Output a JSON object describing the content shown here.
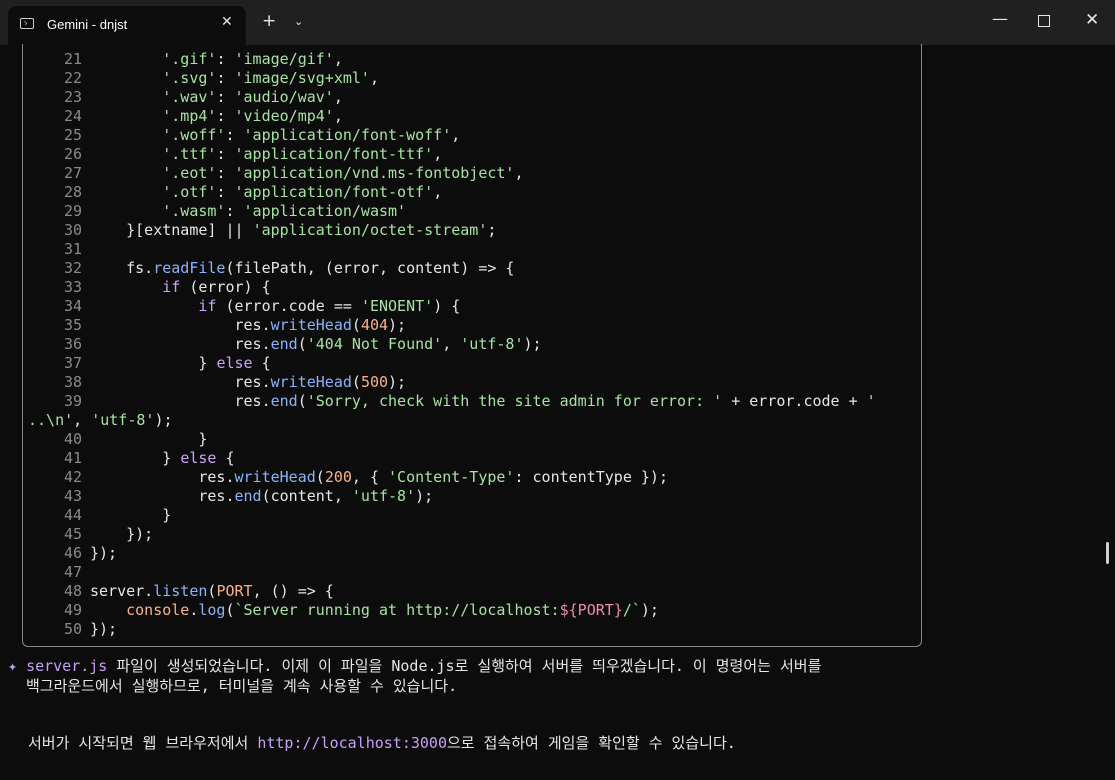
{
  "window": {
    "tab_title": "Gemini - dnjst",
    "close_glyph": "✕",
    "newtab_glyph": "+",
    "dropdown_glyph": "⌄",
    "min_glyph": "—",
    "close_win_glyph": "✕"
  },
  "code_lines": [
    {
      "num": "21",
      "segs": [
        [
          "p",
          "        "
        ],
        [
          "s",
          "'.gif'"
        ],
        [
          "p",
          ": "
        ],
        [
          "s",
          "'image/gif'"
        ],
        [
          "p",
          ","
        ]
      ]
    },
    {
      "num": "22",
      "segs": [
        [
          "p",
          "        "
        ],
        [
          "s",
          "'.svg'"
        ],
        [
          "p",
          ": "
        ],
        [
          "s",
          "'image/svg+xml'"
        ],
        [
          "p",
          ","
        ]
      ]
    },
    {
      "num": "23",
      "segs": [
        [
          "p",
          "        "
        ],
        [
          "s",
          "'.wav'"
        ],
        [
          "p",
          ": "
        ],
        [
          "s",
          "'audio/wav'"
        ],
        [
          "p",
          ","
        ]
      ]
    },
    {
      "num": "24",
      "segs": [
        [
          "p",
          "        "
        ],
        [
          "s",
          "'.mp4'"
        ],
        [
          "p",
          ": "
        ],
        [
          "s",
          "'video/mp4'"
        ],
        [
          "p",
          ","
        ]
      ]
    },
    {
      "num": "25",
      "segs": [
        [
          "p",
          "        "
        ],
        [
          "s",
          "'.woff'"
        ],
        [
          "p",
          ": "
        ],
        [
          "s",
          "'application/font-woff'"
        ],
        [
          "p",
          ","
        ]
      ]
    },
    {
      "num": "26",
      "segs": [
        [
          "p",
          "        "
        ],
        [
          "s",
          "'.ttf'"
        ],
        [
          "p",
          ": "
        ],
        [
          "s",
          "'application/font-ttf'"
        ],
        [
          "p",
          ","
        ]
      ]
    },
    {
      "num": "27",
      "segs": [
        [
          "p",
          "        "
        ],
        [
          "s",
          "'.eot'"
        ],
        [
          "p",
          ": "
        ],
        [
          "s",
          "'application/vnd.ms-fontobject'"
        ],
        [
          "p",
          ","
        ]
      ]
    },
    {
      "num": "28",
      "segs": [
        [
          "p",
          "        "
        ],
        [
          "s",
          "'.otf'"
        ],
        [
          "p",
          ": "
        ],
        [
          "s",
          "'application/font-otf'"
        ],
        [
          "p",
          ","
        ]
      ]
    },
    {
      "num": "29",
      "segs": [
        [
          "p",
          "        "
        ],
        [
          "s",
          "'.wasm'"
        ],
        [
          "p",
          ": "
        ],
        [
          "s",
          "'application/wasm'"
        ]
      ]
    },
    {
      "num": "30",
      "segs": [
        [
          "p",
          "    }[extname] || "
        ],
        [
          "s",
          "'application/octet-stream'"
        ],
        [
          "p",
          ";"
        ]
      ]
    },
    {
      "num": "31",
      "segs": []
    },
    {
      "num": "32",
      "segs": [
        [
          "p",
          "    fs."
        ],
        [
          "f",
          "readFile"
        ],
        [
          "p",
          "(filePath, (error, content) => {"
        ]
      ]
    },
    {
      "num": "33",
      "segs": [
        [
          "p",
          "        "
        ],
        [
          "k",
          "if"
        ],
        [
          "p",
          " (error) {"
        ]
      ]
    },
    {
      "num": "34",
      "segs": [
        [
          "p",
          "            "
        ],
        [
          "k",
          "if"
        ],
        [
          "p",
          " (error.code == "
        ],
        [
          "s",
          "'ENOENT'"
        ],
        [
          "p",
          ") {"
        ]
      ]
    },
    {
      "num": "35",
      "segs": [
        [
          "p",
          "                res."
        ],
        [
          "f",
          "writeHead"
        ],
        [
          "p",
          "("
        ],
        [
          "n",
          "404"
        ],
        [
          "p",
          ");"
        ]
      ]
    },
    {
      "num": "36",
      "segs": [
        [
          "p",
          "                res."
        ],
        [
          "f",
          "end"
        ],
        [
          "p",
          "("
        ],
        [
          "s",
          "'404 Not Found'"
        ],
        [
          "p",
          ", "
        ],
        [
          "s",
          "'utf-8'"
        ],
        [
          "p",
          ");"
        ]
      ]
    },
    {
      "num": "37",
      "segs": [
        [
          "p",
          "            } "
        ],
        [
          "k",
          "else"
        ],
        [
          "p",
          " {"
        ]
      ]
    },
    {
      "num": "38",
      "segs": [
        [
          "p",
          "                res."
        ],
        [
          "f",
          "writeHead"
        ],
        [
          "p",
          "("
        ],
        [
          "n",
          "500"
        ],
        [
          "p",
          ");"
        ]
      ]
    },
    {
      "num": "39",
      "segs": [
        [
          "p",
          "                res."
        ],
        [
          "f",
          "end"
        ],
        [
          "p",
          "("
        ],
        [
          "s",
          "'Sorry, check with the site admin for error: '"
        ],
        [
          "p",
          " + error.code + "
        ],
        [
          "s",
          "'"
        ]
      ]
    },
    {
      "num": "",
      "segs": [
        [
          "s",
          "..\\n'"
        ],
        [
          "p",
          ", "
        ],
        [
          "s",
          "'utf-8'"
        ],
        [
          "p",
          ");"
        ]
      ]
    },
    {
      "num": "40",
      "segs": [
        [
          "p",
          "            }"
        ]
      ]
    },
    {
      "num": "41",
      "segs": [
        [
          "p",
          "        } "
        ],
        [
          "k",
          "else"
        ],
        [
          "p",
          " {"
        ]
      ]
    },
    {
      "num": "42",
      "segs": [
        [
          "p",
          "            res."
        ],
        [
          "f",
          "writeHead"
        ],
        [
          "p",
          "("
        ],
        [
          "n",
          "200"
        ],
        [
          "p",
          ", { "
        ],
        [
          "s",
          "'Content-Type'"
        ],
        [
          "p",
          ": contentType });"
        ]
      ]
    },
    {
      "num": "43",
      "segs": [
        [
          "p",
          "            res."
        ],
        [
          "f",
          "end"
        ],
        [
          "p",
          "(content, "
        ],
        [
          "s",
          "'utf-8'"
        ],
        [
          "p",
          ");"
        ]
      ]
    },
    {
      "num": "44",
      "segs": [
        [
          "p",
          "        }"
        ]
      ]
    },
    {
      "num": "45",
      "segs": [
        [
          "p",
          "    });"
        ]
      ]
    },
    {
      "num": "46",
      "segs": [
        [
          "p",
          "});"
        ]
      ]
    },
    {
      "num": "47",
      "segs": []
    },
    {
      "num": "48",
      "segs": [
        [
          "p",
          "server."
        ],
        [
          "f",
          "listen"
        ],
        [
          "p",
          "("
        ],
        [
          "n",
          "PORT"
        ],
        [
          "p",
          ", () => {"
        ]
      ]
    },
    {
      "num": "49",
      "segs": [
        [
          "p",
          "    "
        ],
        [
          "n",
          "console"
        ],
        [
          "p",
          "."
        ],
        [
          "f",
          "log"
        ],
        [
          "p",
          "("
        ],
        [
          "s",
          "`Server running at http://localhost:"
        ],
        [
          "t",
          "${PORT}"
        ],
        [
          "s",
          "/`"
        ],
        [
          "p",
          ");"
        ]
      ]
    },
    {
      "num": "50",
      "segs": [
        [
          "p",
          "});"
        ]
      ]
    }
  ],
  "message": {
    "star": "✦",
    "file": "server.js",
    "line1": " 파일이 생성되었습니다. 이제 이 파일을 Node.js로 실행하여 서버를 띄우겠습니다. 이 명령어는 서버를",
    "line2": "  백그라운드에서 실행하므로, 터미널을 계속 사용할 수 있습니다.",
    "line3_pre": "서버가 시작되면 웹 브라우저에서 ",
    "url": "http://localhost:3000",
    "line3_post": "으로 접속하여 게임을 확인할 수 있습니다."
  }
}
